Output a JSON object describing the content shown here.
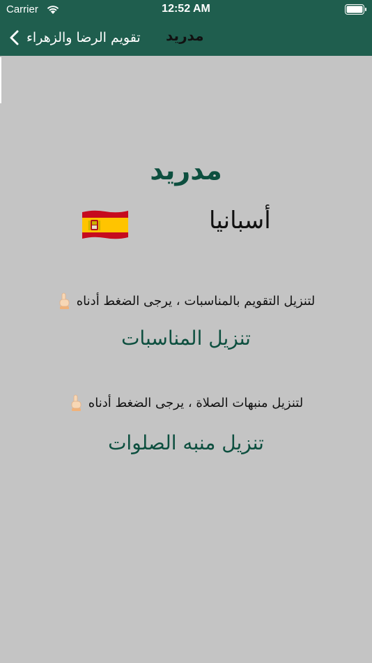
{
  "status_bar": {
    "carrier": "Carrier",
    "time": "12:52 AM"
  },
  "nav": {
    "back_label": "تقويم الرضا والزهراء",
    "title": "مدريد"
  },
  "main": {
    "city": "مدريد",
    "country": "أسبانيا",
    "flag_icon": "spain-flag-icon",
    "events_instruction": "لتنزيل التقويم بالمناسبات ، يرجى الضغط أدناه",
    "events_button": "تنزيل المناسبات",
    "prayer_instruction": "لتنزيل منبهات الصلاة ، يرجى الضغط أدناه",
    "prayer_button": "تنزيل منبه الصلوات",
    "pointing_icon": "pointing-down-hand-icon"
  },
  "colors": {
    "header": "#1f5e4e",
    "background": "#c4c4c4",
    "accent_text": "#0d4f3f"
  }
}
